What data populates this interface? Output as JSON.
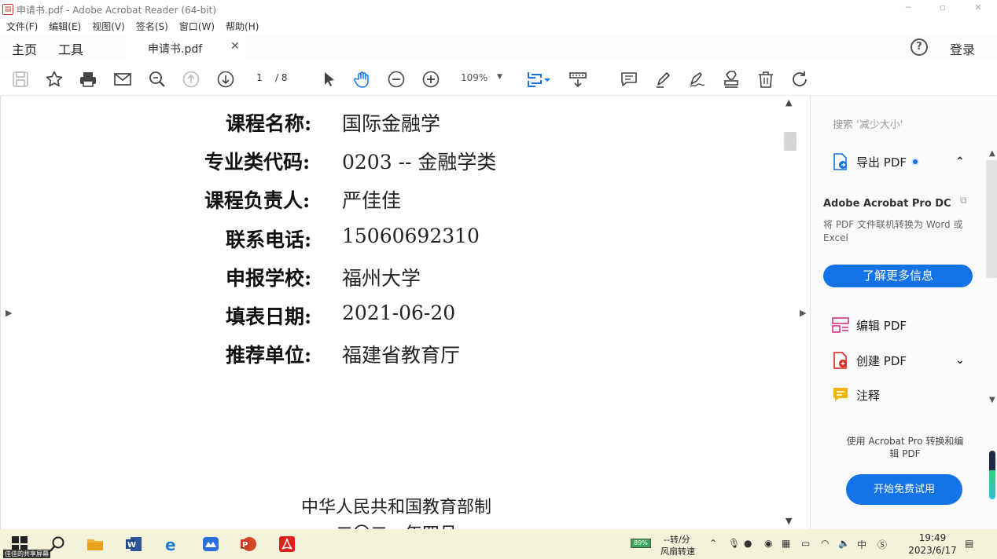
{
  "window": {
    "title": "申请书.pdf - Adobe Acrobat Reader (64-bit)",
    "minimize": "─",
    "maximize": "▫",
    "close": "✕"
  },
  "menu": [
    "文件(F)",
    "编辑(E)",
    "视图(V)",
    "签名(S)",
    "窗口(W)",
    "帮助(H)"
  ],
  "tabs": {
    "home": "主页",
    "tools": "工具",
    "document": "申请书.pdf",
    "close": "✕"
  },
  "header": {
    "help": "?",
    "login": "登录"
  },
  "toolbar": {
    "page_current": "1",
    "page_total": "/ 8",
    "zoom": "109%",
    "icons": [
      "save-icon",
      "star-icon",
      "print-icon",
      "mail-icon",
      "zoom-search-icon",
      "page-up-icon",
      "page-down-icon",
      "select-cursor-icon",
      "hand-icon",
      "zoom-out-icon",
      "zoom-in-icon",
      "fit-page-icon",
      "scroll-mode-icon",
      "comment-icon",
      "highlight-pen-icon",
      "sign-icon",
      "stamp-icon",
      "delete-icon",
      "rotate-icon"
    ]
  },
  "document": {
    "fields": [
      {
        "label": "课程名称:",
        "value": "国际金融学"
      },
      {
        "label": "专业类代码:",
        "value": "0203 -- 金融学类"
      },
      {
        "label": "课程负责人:",
        "value": "严佳佳"
      },
      {
        "label": "联系电话:",
        "value": "15060692310"
      },
      {
        "label": "申报学校:",
        "value": "福州大学"
      },
      {
        "label": "填表日期:",
        "value": "2021-06-20"
      },
      {
        "label": "推荐单位:",
        "value": "福建省教育厅"
      }
    ],
    "footer_org": "中华人民共和国教育部制",
    "footer_date": "二〇二一年四月"
  },
  "right_pane": {
    "search_placeholder": "搜索 '减少大小'",
    "export_pdf": "导出 PDF",
    "promo_title": "Adobe Acrobat Pro DC",
    "promo_desc": "将 PDF 文件联机转换为 Word 或 Excel",
    "learn_more": "了解更多信息",
    "edit_pdf": "编辑 PDF",
    "create_pdf": "创建 PDF",
    "comment": "注释",
    "pro_text": "使用 Acrobat Pro 转换和编辑 PDF",
    "trial": "开始免费试用"
  },
  "taskbar": {
    "share_label": "佳佳的共享屏幕",
    "battery": "89%",
    "speed_line1": "--转/分",
    "speed_line2": "风扇转速",
    "ime": "中",
    "time": "19:49",
    "date": "2023/6/17"
  },
  "colors": {
    "accent": "#1473e6",
    "acrobat_red": "#e0201b"
  }
}
